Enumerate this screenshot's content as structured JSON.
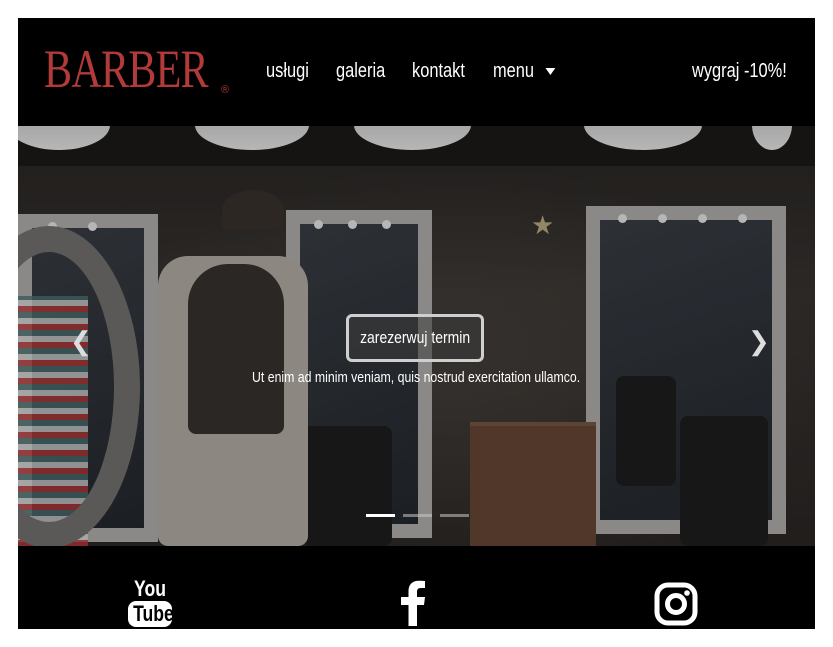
{
  "brand": {
    "name": "BARBER",
    "reg": "®",
    "color": "#b23a3a"
  },
  "nav": {
    "items": [
      {
        "label": "usługi"
      },
      {
        "label": "galeria"
      },
      {
        "label": "kontakt"
      },
      {
        "label": "menu"
      }
    ],
    "promo": "wygraj -10%!"
  },
  "hero": {
    "cta_label": "zarezerwuj termin",
    "tagline": "Ut enim ad minim veniam, quis nostrud exercitation ullamco.",
    "prev_icon": "chevron-left-icon",
    "next_icon": "chevron-right-icon",
    "slides_total": 3,
    "active_slide": 1
  },
  "footer": {
    "youtube": {
      "top": "You",
      "bottom": "Tube"
    },
    "icons": [
      "youtube-icon",
      "facebook-icon",
      "instagram-icon"
    ]
  }
}
